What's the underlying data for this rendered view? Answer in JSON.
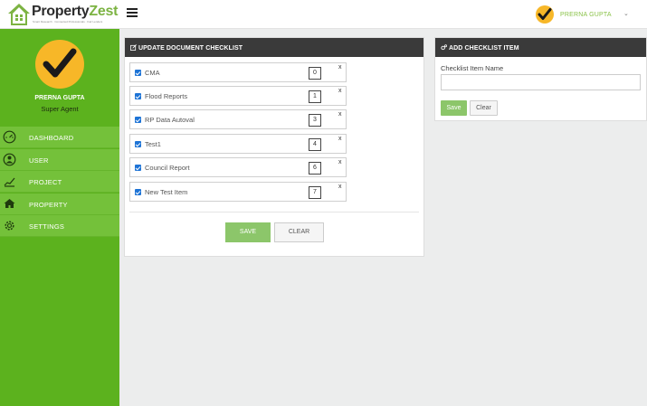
{
  "header": {
    "brand_left": "Property",
    "brand_right": "Zest",
    "tagline": "Smart Research · Connected Professionals · Fair Lenders",
    "user_name": "PRERNA GUPTA",
    "caret": "⌄"
  },
  "sidebar": {
    "profile_name": "PRERNA GUPTA",
    "profile_role": "Super Agent",
    "items": [
      {
        "label": "DASHBOARD",
        "icon": "dashboard-icon"
      },
      {
        "label": "USER",
        "icon": "user-icon"
      },
      {
        "label": "PROJECT",
        "icon": "project-icon"
      },
      {
        "label": "PROPERTY",
        "icon": "property-icon"
      },
      {
        "label": "SETTINGS",
        "icon": "gear-icon"
      }
    ]
  },
  "update_panel": {
    "title": "UPDATE DOCUMENT CHECKLIST",
    "items": [
      {
        "label": "CMA",
        "order": "0",
        "checked": true,
        "remove": "x"
      },
      {
        "label": "Flood Reports",
        "order": "1",
        "checked": true,
        "remove": "x"
      },
      {
        "label": "RP Data Autoval",
        "order": "3",
        "checked": true,
        "remove": "x"
      },
      {
        "label": "Test1",
        "order": "4",
        "checked": true,
        "remove": "x"
      },
      {
        "label": "Council Report",
        "order": "6",
        "checked": true,
        "remove": "x"
      },
      {
        "label": "New Test Item",
        "order": "7",
        "checked": true,
        "remove": "x"
      }
    ],
    "save_label": "SAVE",
    "clear_label": "CLEAR"
  },
  "add_panel": {
    "title": "ADD CHECKLIST ITEM",
    "field_label": "Checklist Item Name",
    "field_value": "",
    "save_label": "Save",
    "clear_label": "Clear"
  },
  "colors": {
    "brand_green": "#5cb21e",
    "nav_item": "#74c13a",
    "panel_header": "#3a3a3a",
    "save_button": "#8cc66a",
    "avatar_yellow": "#f7b728"
  }
}
